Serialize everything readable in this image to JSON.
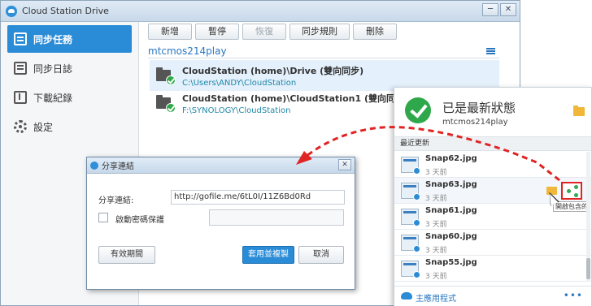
{
  "window": {
    "title": "Cloud Station Drive",
    "minimize": "─",
    "close": "✕"
  },
  "sidebar": {
    "items": [
      {
        "label": "同步任務",
        "icon": "sync-task-icon",
        "active": true
      },
      {
        "label": "同步日誌",
        "icon": "log-icon"
      },
      {
        "label": "下載紀錄",
        "icon": "download-log-icon"
      },
      {
        "label": "設定",
        "icon": "gear-icon"
      }
    ]
  },
  "toolbar": {
    "new_label": "新增",
    "pause_label": "暫停",
    "resume_label": "恢復",
    "sync_rules_label": "同步規則",
    "delete_label": "刪除"
  },
  "server": {
    "name": "mtcmos214play"
  },
  "tasks": [
    {
      "name": "CloudStation (home)\\Drive (雙向同步)",
      "path": "C:\\Users\\ANDY\\CloudStation"
    },
    {
      "name": "CloudStation (home)\\CloudStation1 (雙向同步)",
      "path": "F:\\SYNOLOGY\\CloudStation"
    }
  ],
  "dialog": {
    "title": "分享連結",
    "close": "✕",
    "link_label": "分享連結:",
    "link_value": "http://gofile.me/6tL0I/11Z6Bd0Rd",
    "password_label": "啟動密碼保護",
    "validity_button": "有效期間",
    "copy_button": "套用並複製",
    "cancel_button": "取消"
  },
  "popup": {
    "status_title": "已是最新狀態",
    "status_user": "mtcmos214play",
    "recent_header": "最近更新",
    "files": [
      {
        "name": "Snap62.jpg",
        "time": "3 天前"
      },
      {
        "name": "Snap63.jpg",
        "time": "3 天前"
      },
      {
        "name": "Snap61.jpg",
        "time": "3 天前"
      },
      {
        "name": "Snap60.jpg",
        "time": "3 天前"
      },
      {
        "name": "Snap55.jpg",
        "time": "3 天前"
      }
    ],
    "tooltip": "開啟包含的",
    "footer_label": "主應用程式",
    "more": "•••"
  },
  "colors": {
    "accent": "#2a8bd6",
    "ok_green": "#2ea84a",
    "highlight_red": "#e02424",
    "folder_yellow": "#f0b73a"
  }
}
